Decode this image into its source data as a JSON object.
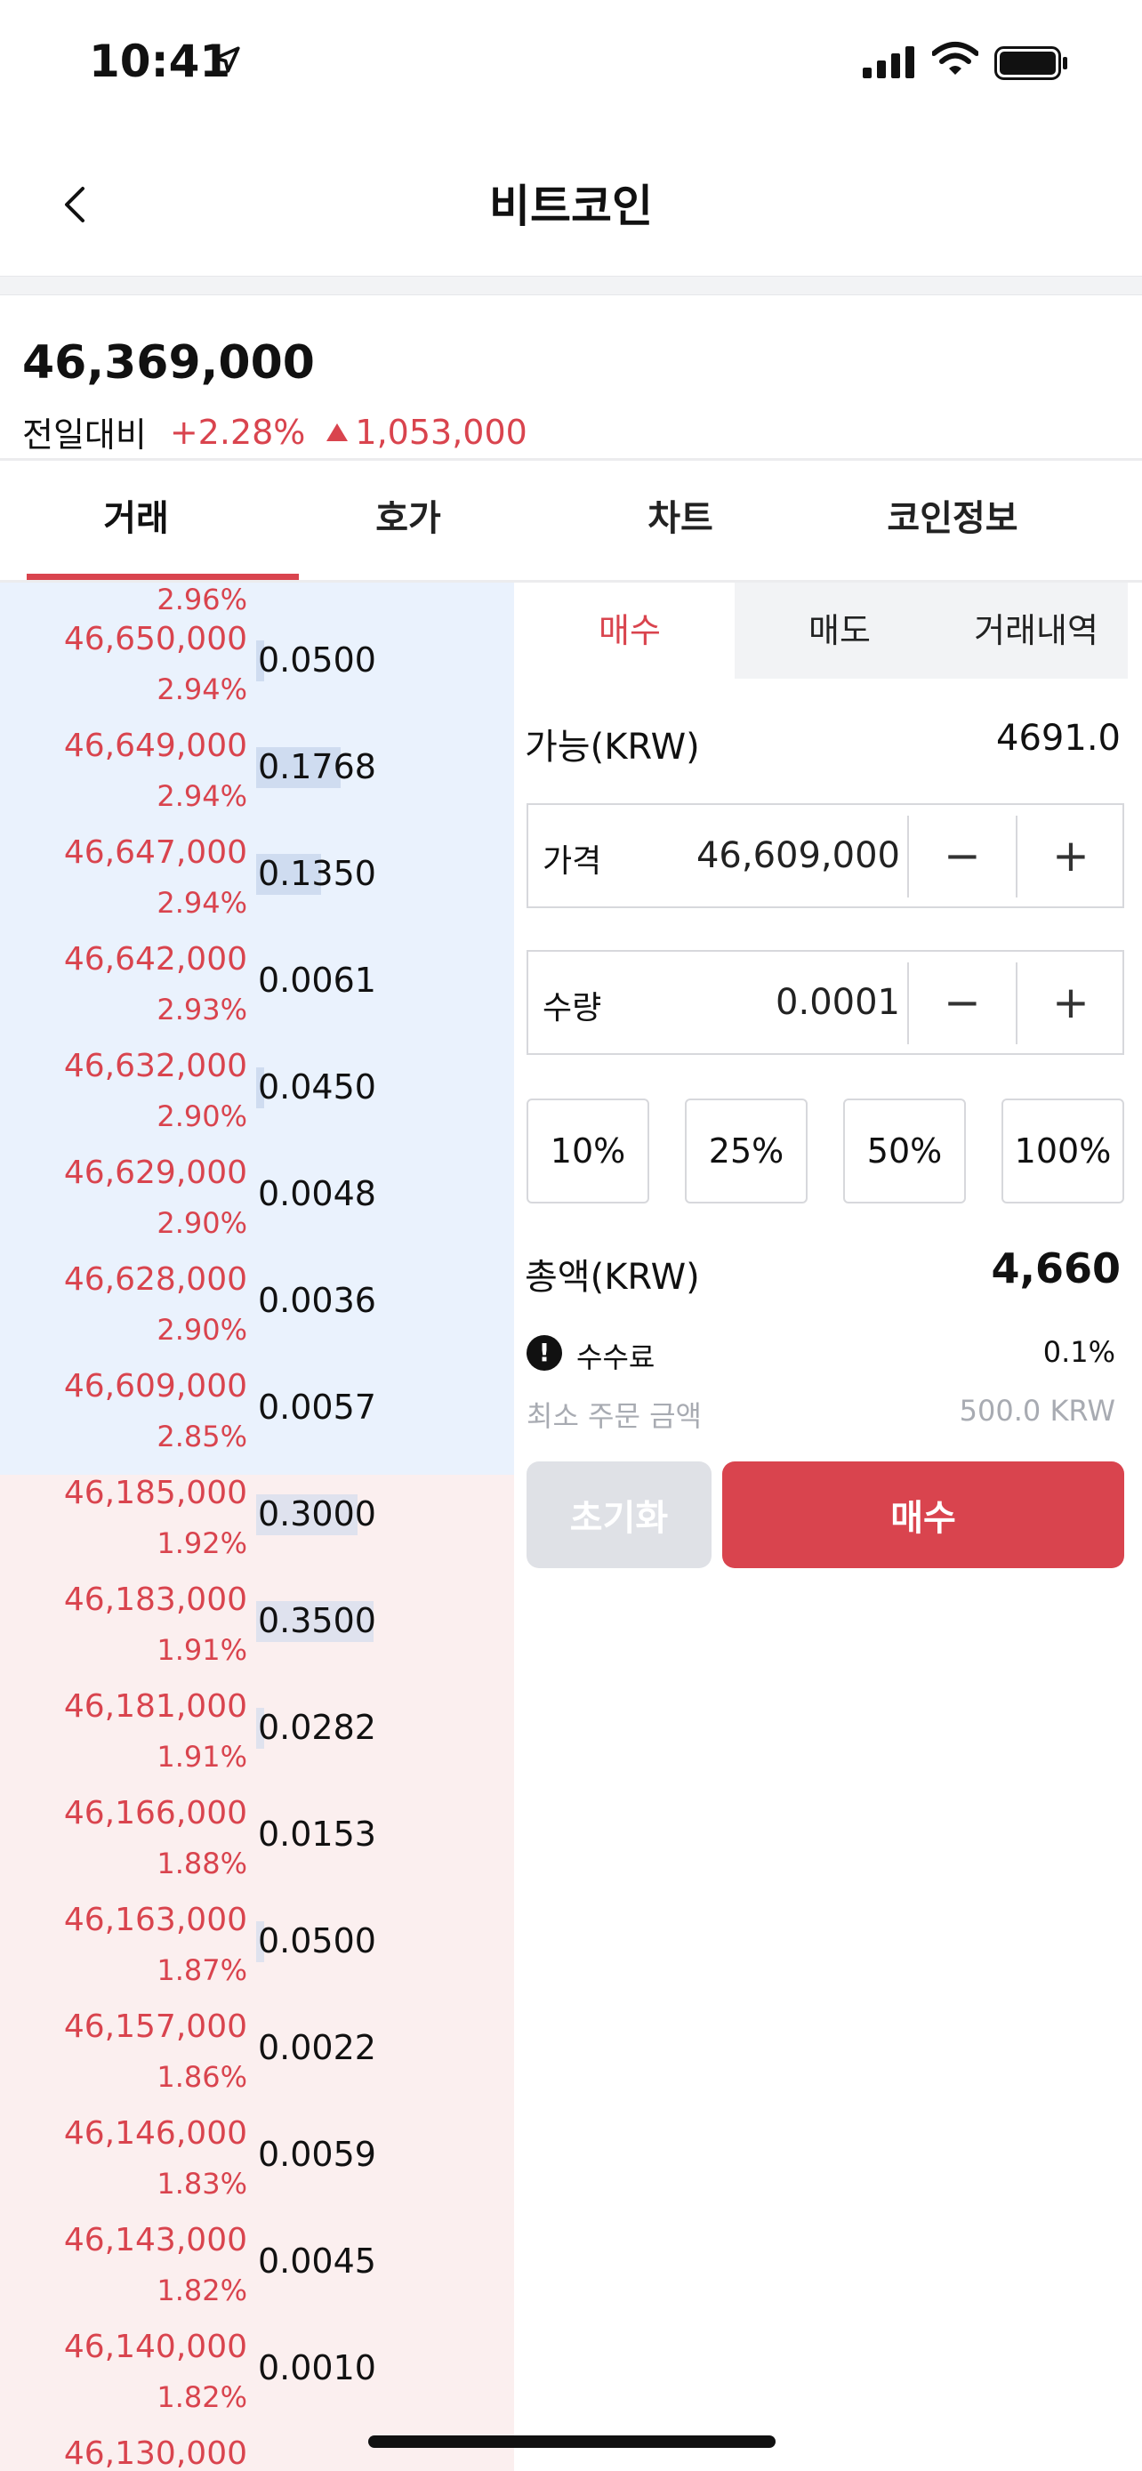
{
  "status_bar": {
    "time": "10:41"
  },
  "nav": {
    "title": "비트코인"
  },
  "header": {
    "price": "46,369,000",
    "change_label": "전일대비",
    "change_pct": "+2.28%",
    "change_amt": "1,053,000",
    "colors": {
      "up": "#d9444e"
    }
  },
  "tabs": [
    "거래",
    "호가",
    "차트",
    "코인정보"
  ],
  "orderbook": {
    "top_partial_pct": "2.96%",
    "asks": [
      {
        "price": "46,650,000",
        "pct": "2.94%",
        "qty": "0.0500",
        "fill": 0.07
      },
      {
        "price": "46,649,000",
        "pct": "2.94%",
        "qty": "0.1768",
        "fill": 0.72
      },
      {
        "price": "46,647,000",
        "pct": "2.94%",
        "qty": "0.1350",
        "fill": 0.55
      },
      {
        "price": "46,642,000",
        "pct": "2.93%",
        "qty": "0.0061",
        "fill": 0
      },
      {
        "price": "46,632,000",
        "pct": "2.90%",
        "qty": "0.0450",
        "fill": 0.07
      },
      {
        "price": "46,629,000",
        "pct": "2.90%",
        "qty": "0.0048",
        "fill": 0
      },
      {
        "price": "46,628,000",
        "pct": "2.90%",
        "qty": "0.0036",
        "fill": 0
      },
      {
        "price": "46,609,000",
        "pct": "2.85%",
        "qty": "0.0057",
        "fill": 0
      }
    ],
    "bids": [
      {
        "price": "46,185,000",
        "pct": "1.92%",
        "qty": "0.3000",
        "fill": 0.86
      },
      {
        "price": "46,183,000",
        "pct": "1.91%",
        "qty": "0.3500",
        "fill": 1.0
      },
      {
        "price": "46,181,000",
        "pct": "1.91%",
        "qty": "0.0282",
        "fill": 0.07
      },
      {
        "price": "46,166,000",
        "pct": "1.88%",
        "qty": "0.0153",
        "fill": 0
      },
      {
        "price": "46,163,000",
        "pct": "1.87%",
        "qty": "0.0500",
        "fill": 0.07
      },
      {
        "price": "46,157,000",
        "pct": "1.86%",
        "qty": "0.0022",
        "fill": 0
      },
      {
        "price": "46,146,000",
        "pct": "1.83%",
        "qty": "0.0059",
        "fill": 0
      },
      {
        "price": "46,143,000",
        "pct": "1.82%",
        "qty": "0.0045",
        "fill": 0
      },
      {
        "price": "46,140,000",
        "pct": "1.82%",
        "qty": "0.0010",
        "fill": 0
      },
      {
        "price": "46,130,000",
        "pct": "",
        "qty": "",
        "fill": 0
      }
    ]
  },
  "order_panel": {
    "sub_tabs": [
      "매수",
      "매도",
      "거래내역"
    ],
    "available_label": "가능(KRW)",
    "available_value": "4691.0",
    "price_label": "가격",
    "price_value": "46,609,000",
    "qty_label": "수량",
    "qty_value": "0.0001",
    "minus": "−",
    "plus": "+",
    "pct_buttons": [
      "10%",
      "25%",
      "50%",
      "100%"
    ],
    "total_label": "총액(KRW)",
    "total_value": "4,660",
    "fee_label": "수수료",
    "fee_value": "0.1%",
    "min_label": "최소 주문 금액",
    "min_value": "500.0 KRW",
    "reset_label": "초기화",
    "buy_label": "매수"
  }
}
